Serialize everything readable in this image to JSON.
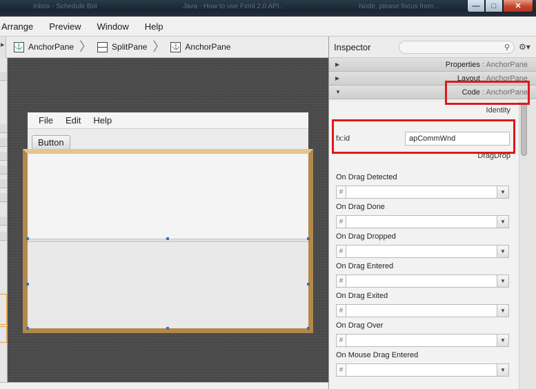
{
  "titlebar": {
    "ghost": [
      "Inbox - Schedule Bot",
      "Java - How to use Fxml 2.0 API..",
      "Node, please focus from..."
    ],
    "buttons": {
      "minimize": "—",
      "maximize": "□",
      "close": "✕"
    }
  },
  "menubar": {
    "items": [
      "Arrange",
      "Preview",
      "Window",
      "Help"
    ]
  },
  "breadcrumb": {
    "items": [
      "AnchorPane",
      "SplitPane",
      "AnchorPane"
    ]
  },
  "preview": {
    "menu": [
      "File",
      "Edit",
      "Help"
    ],
    "button_label": "Button"
  },
  "inspector": {
    "title": "Inspector",
    "search_placeholder": "",
    "sections": [
      {
        "name": "Properties",
        "sub": "AnchorPane",
        "expanded": false
      },
      {
        "name": "Layout",
        "sub": "AnchorPane",
        "expanded": false
      },
      {
        "name": "Code",
        "sub": "AnchorPane",
        "expanded": true
      }
    ],
    "identity_header": "Identity",
    "fxid_label": "fx:id",
    "fxid_value": "apCommWnd",
    "dragdrop_header": "DragDrop",
    "events": [
      {
        "label": "On Drag Detected",
        "hash": "#"
      },
      {
        "label": "On Drag Done",
        "hash": "#"
      },
      {
        "label": "On Drag Dropped",
        "hash": "#"
      },
      {
        "label": "On Drag Entered",
        "hash": "#"
      },
      {
        "label": "On Drag Exited",
        "hash": "#"
      },
      {
        "label": "On Drag Over",
        "hash": "#"
      },
      {
        "label": "On Mouse Drag Entered",
        "hash": "#"
      }
    ]
  },
  "colors": {
    "highlight_red": "#e01818",
    "anchor_border": "#b3884a"
  },
  "icons": {
    "search": "magnifier-icon",
    "gear": "gear-icon",
    "expand": "triangle-right-icon",
    "collapse": "triangle-down-icon"
  }
}
